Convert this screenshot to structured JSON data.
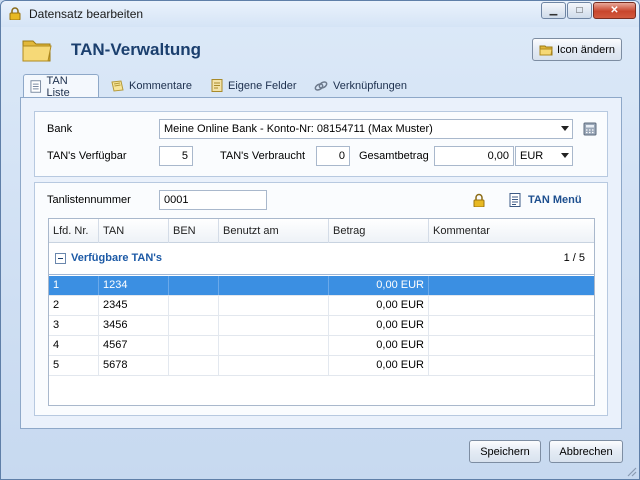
{
  "window": {
    "title": "Datensatz bearbeiten"
  },
  "header": {
    "title": "TAN-Verwaltung",
    "icon_button": "Icon ändern"
  },
  "tabs": [
    {
      "label": "TAN Liste",
      "icon": "list-icon",
      "active": true
    },
    {
      "label": "Kommentare",
      "icon": "note-icon",
      "active": false
    },
    {
      "label": "Eigene Felder",
      "icon": "form-icon",
      "active": false
    },
    {
      "label": "Verknüpfungen",
      "icon": "link-icon",
      "active": false
    }
  ],
  "bank": {
    "label": "Bank",
    "value": "Meine Online Bank - Konto-Nr: 08154711 (Max Muster)"
  },
  "stats": {
    "available_label": "TAN's Verfügbar",
    "available_value": "5",
    "used_label": "TAN's Verbraucht",
    "used_value": "0",
    "total_label": "Gesamtbetrag",
    "total_value": "0,00",
    "currency": "EUR"
  },
  "list": {
    "number_label": "Tanlistennummer",
    "number_value": "0001",
    "menu_label": "TAN Menü"
  },
  "grid": {
    "columns": [
      "Lfd. Nr.",
      "TAN",
      "BEN",
      "Benutzt am",
      "Betrag",
      "Kommentar"
    ],
    "group_title": "Verfügbare TAN's",
    "group_count": "1 / 5",
    "rows": [
      {
        "nr": "1",
        "tan": "1234",
        "ben": "",
        "used": "",
        "amount": "0,00 EUR",
        "comment": ""
      },
      {
        "nr": "2",
        "tan": "2345",
        "ben": "",
        "used": "",
        "amount": "0,00 EUR",
        "comment": ""
      },
      {
        "nr": "3",
        "tan": "3456",
        "ben": "",
        "used": "",
        "amount": "0,00 EUR",
        "comment": ""
      },
      {
        "nr": "4",
        "tan": "4567",
        "ben": "",
        "used": "",
        "amount": "0,00 EUR",
        "comment": ""
      },
      {
        "nr": "5",
        "tan": "5678",
        "ben": "",
        "used": "",
        "amount": "0,00 EUR",
        "comment": ""
      }
    ]
  },
  "footer": {
    "save_label": "Speichern",
    "cancel_label": "Abbrechen"
  },
  "colors": {
    "selection": "#3b8fe2",
    "title_blue": "#1b3f6e",
    "group_blue": "#1d5aa6"
  }
}
